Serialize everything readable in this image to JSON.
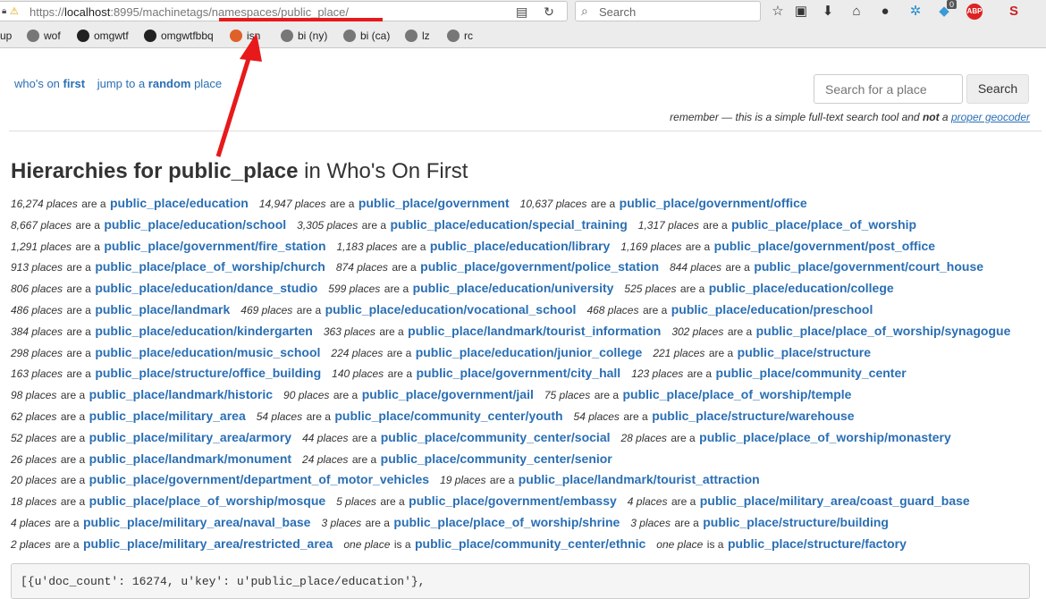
{
  "browser": {
    "url_prefix": "https://",
    "url_host": "localhost",
    "url_rest": ":8995/machinetags/namespaces/public_place/",
    "search_placeholder": "Search",
    "abp_label": "ABP",
    "badge_count": "0"
  },
  "bookmarks": [
    {
      "label": "up"
    },
    {
      "label": "wof",
      "icon": "globe-icon"
    },
    {
      "label": "omgwtf",
      "icon": "github-icon"
    },
    {
      "label": "omgwtfbbq",
      "icon": "github-icon"
    },
    {
      "label": "isn",
      "icon": "ubuntu-icon"
    },
    {
      "label": "bi (ny)",
      "icon": "globe-icon"
    },
    {
      "label": "bi (ca)",
      "icon": "globe-icon"
    },
    {
      "label": "lz",
      "icon": "globe-icon"
    },
    {
      "label": "rc",
      "icon": "globe-icon"
    }
  ],
  "nav": {
    "wof_prefix": "who's on ",
    "wof_bold": "first",
    "random_prefix": "jump to a ",
    "random_bold": "random",
    "random_suffix": " place"
  },
  "search": {
    "placeholder": "Search for a place",
    "button": "Search",
    "remember_prefix": "remember — this is a simple full-text search tool and ",
    "remember_bold": "not",
    "remember_mid": " a ",
    "remember_link": "proper geocoder"
  },
  "heading": {
    "prefix": "Hierarchies for ",
    "bold": "public_place",
    "suffix": " in Who's On First"
  },
  "rows": [
    [
      [
        "16,274 places",
        "are a",
        "public_place/education"
      ],
      [
        "14,947 places",
        "are a",
        "public_place/government"
      ],
      [
        "10,637 places",
        "are a",
        "public_place/government/office"
      ]
    ],
    [
      [
        "8,667 places",
        "are a",
        "public_place/education/school"
      ],
      [
        "3,305 places",
        "are a",
        "public_place/education/special_training"
      ],
      [
        "1,317 places",
        "are a",
        "public_place/place_of_worship"
      ]
    ],
    [
      [
        "1,291 places",
        "are a",
        "public_place/government/fire_station"
      ],
      [
        "1,183 places",
        "are a",
        "public_place/education/library"
      ],
      [
        "1,169 places",
        "are a",
        "public_place/government/post_office"
      ]
    ],
    [
      [
        "913 places",
        "are a",
        "public_place/place_of_worship/church"
      ],
      [
        "874 places",
        "are a",
        "public_place/government/police_station"
      ],
      [
        "844 places",
        "are a",
        "public_place/government/court_house"
      ]
    ],
    [
      [
        "806 places",
        "are a",
        "public_place/education/dance_studio"
      ],
      [
        "599 places",
        "are a",
        "public_place/education/university"
      ],
      [
        "525 places",
        "are a",
        "public_place/education/college"
      ]
    ],
    [
      [
        "486 places",
        "are a",
        "public_place/landmark"
      ],
      [
        "469 places",
        "are a",
        "public_place/education/vocational_school"
      ],
      [
        "468 places",
        "are a",
        "public_place/education/preschool"
      ]
    ],
    [
      [
        "384 places",
        "are a",
        "public_place/education/kindergarten"
      ],
      [
        "363 places",
        "are a",
        "public_place/landmark/tourist_information"
      ],
      [
        "302 places",
        "are a",
        "public_place/place_of_worship/synagogue"
      ]
    ],
    [
      [
        "298 places",
        "are a",
        "public_place/education/music_school"
      ],
      [
        "224 places",
        "are a",
        "public_place/education/junior_college"
      ],
      [
        "221 places",
        "are a",
        "public_place/structure"
      ]
    ],
    [
      [
        "163 places",
        "are a",
        "public_place/structure/office_building"
      ],
      [
        "140 places",
        "are a",
        "public_place/government/city_hall"
      ],
      [
        "123 places",
        "are a",
        "public_place/community_center"
      ]
    ],
    [
      [
        "98 places",
        "are a",
        "public_place/landmark/historic"
      ],
      [
        "90 places",
        "are a",
        "public_place/government/jail"
      ],
      [
        "75 places",
        "are a",
        "public_place/place_of_worship/temple"
      ]
    ],
    [
      [
        "62 places",
        "are a",
        "public_place/military_area"
      ],
      [
        "54 places",
        "are a",
        "public_place/community_center/youth"
      ],
      [
        "54 places",
        "are a",
        "public_place/structure/warehouse"
      ]
    ],
    [
      [
        "52 places",
        "are a",
        "public_place/military_area/armory"
      ],
      [
        "44 places",
        "are a",
        "public_place/community_center/social"
      ],
      [
        "28 places",
        "are a",
        "public_place/place_of_worship/monastery"
      ]
    ],
    [
      [
        "26 places",
        "are a",
        "public_place/landmark/monument"
      ],
      [
        "24 places",
        "are a",
        "public_place/community_center/senior"
      ]
    ],
    [
      [
        "20 places",
        "are a",
        "public_place/government/department_of_motor_vehicles"
      ],
      [
        "19 places",
        "are a",
        "public_place/landmark/tourist_attraction"
      ]
    ],
    [
      [
        "18 places",
        "are a",
        "public_place/place_of_worship/mosque"
      ],
      [
        "5 places",
        "are a",
        "public_place/government/embassy"
      ],
      [
        "4 places",
        "are a",
        "public_place/military_area/coast_guard_base"
      ]
    ],
    [
      [
        "4 places",
        "are a",
        "public_place/military_area/naval_base"
      ],
      [
        "3 places",
        "are a",
        "public_place/place_of_worship/shrine"
      ],
      [
        "3 places",
        "are a",
        "public_place/structure/building"
      ]
    ],
    [
      [
        "2 places",
        "are a",
        "public_place/military_area/restricted_area"
      ],
      [
        "one place",
        "is a",
        "public_place/community_center/ethnic"
      ],
      [
        "one place",
        "is a",
        "public_place/structure/factory"
      ]
    ]
  ],
  "raw_output": "[{u'doc_count': 16274, u'key': u'public_place/education'},",
  "annotation": {
    "color": "#e8191a"
  }
}
